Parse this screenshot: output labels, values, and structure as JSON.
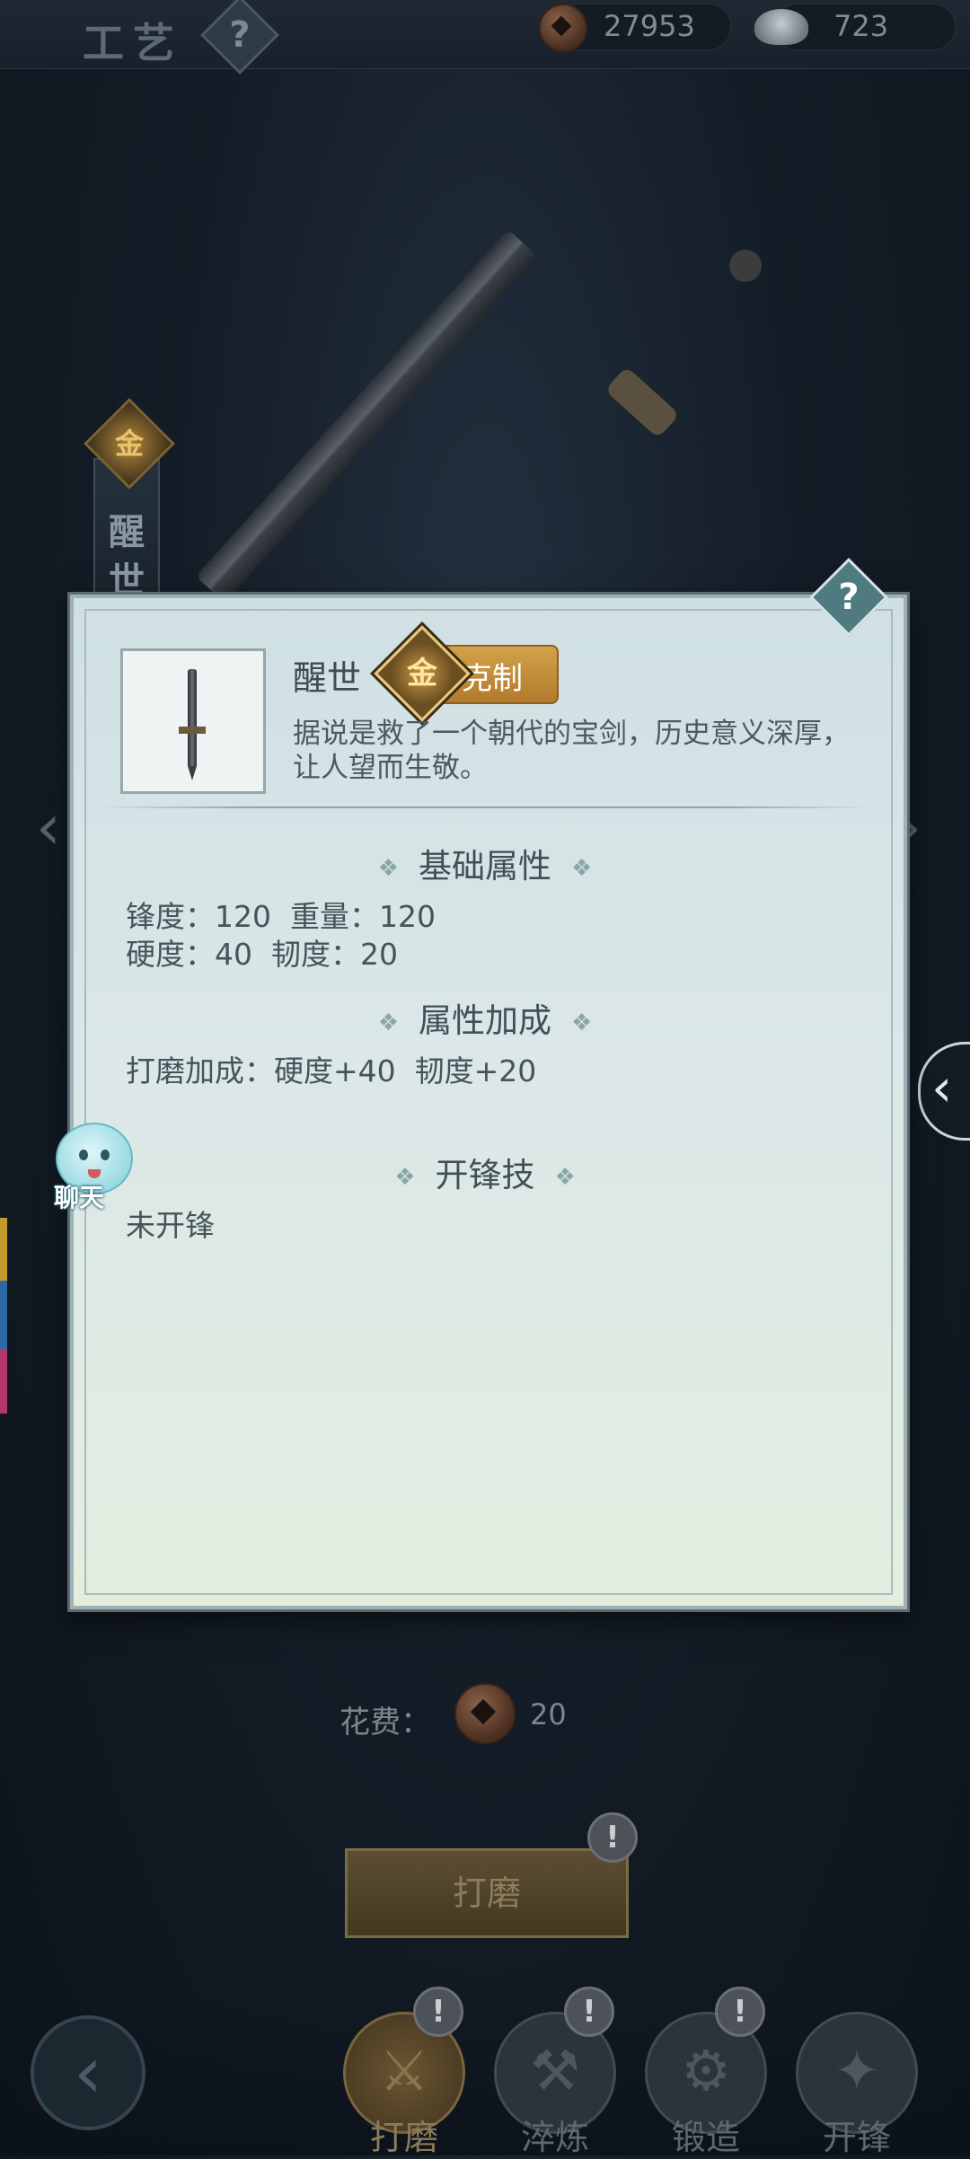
{
  "header": {
    "title": "工艺",
    "help_icon": "?",
    "currencies": [
      {
        "icon": "coin-icon",
        "value": "27953"
      },
      {
        "icon": "silver-ingot-icon",
        "value": "723"
      }
    ]
  },
  "background": {
    "weapon_banner": "醒世",
    "weapon_banner_badge": "金"
  },
  "panel": {
    "help_icon": "?",
    "weapon": {
      "name": "醒世",
      "grade_badge": "金",
      "tag": "克制",
      "description": "据说是救了一个朝代的宝剑，历史意义深厚，让人望而生敬。"
    },
    "sections": {
      "base": {
        "title": "基础属性",
        "line1": "锋度：120  重量：120",
        "line2": "硬度：40  韧度：20"
      },
      "bonus": {
        "title": "属性加成",
        "line1": "打磨加成：硬度+40  韧度+20"
      },
      "skill": {
        "title": "开锋技",
        "line1": "未开锋"
      }
    },
    "diamond": "❖"
  },
  "chat": {
    "label": "聊天"
  },
  "cost": {
    "label": "花费：",
    "value": "20"
  },
  "action_button": {
    "label": "打磨",
    "alert": "!"
  },
  "bottom_nav": [
    {
      "label": "打磨",
      "icon": "polish-icon",
      "alert": "!",
      "active": true
    },
    {
      "label": "淬炼",
      "icon": "temper-icon",
      "alert": "!"
    },
    {
      "label": "锻造",
      "icon": "forge-icon",
      "alert": "!"
    },
    {
      "label": "开锋",
      "icon": "sharpen-icon"
    }
  ],
  "colors": {
    "panel_bg": "#d8e6e6",
    "tag_gold": "#c48f3c",
    "help_teal": "#4f7b80"
  }
}
